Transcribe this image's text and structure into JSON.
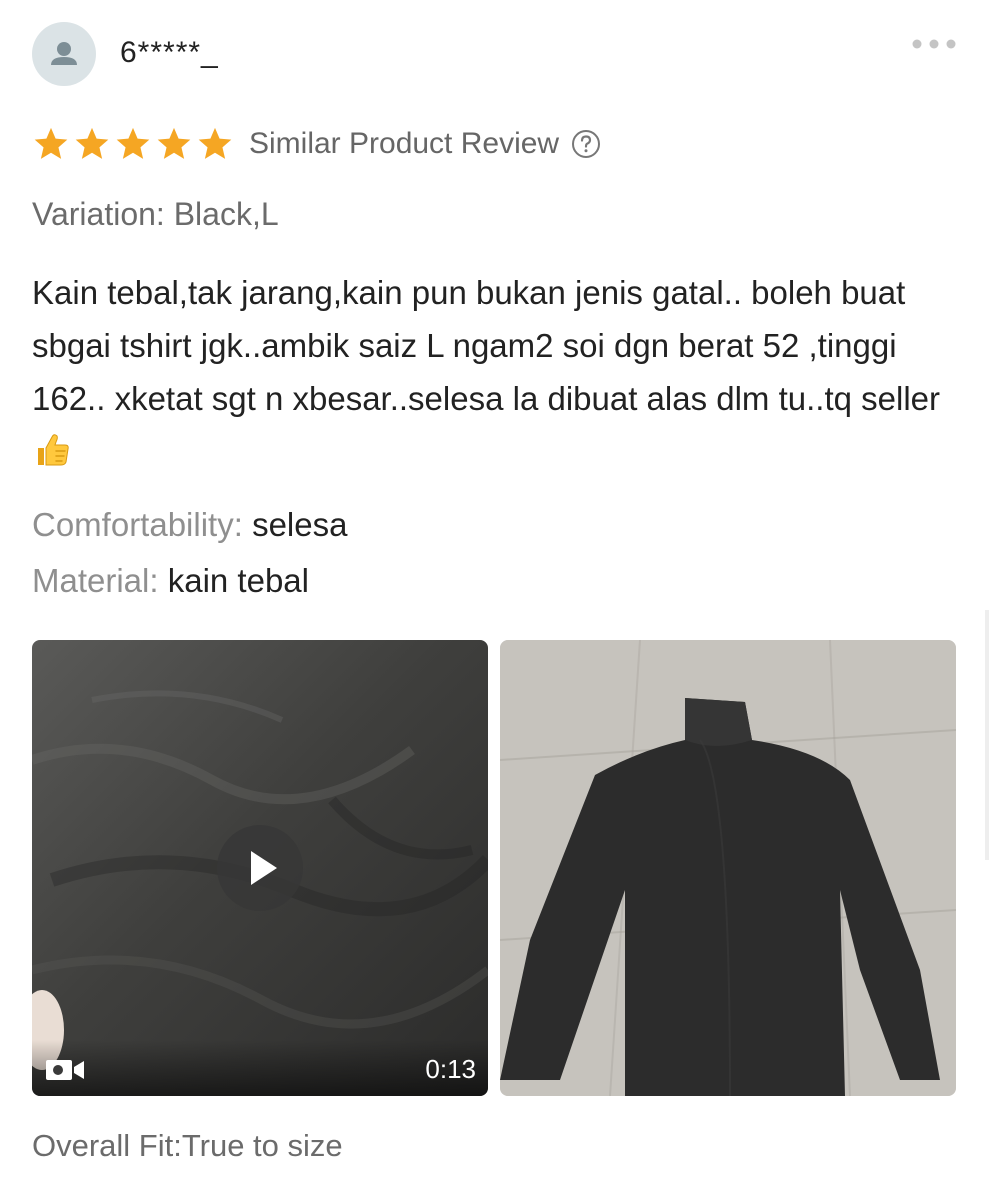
{
  "review": {
    "username": "6*****_",
    "rating": 5,
    "rating_max": 5,
    "similar_label": "Similar Product Review",
    "variation": "Variation: Black,L",
    "text": "Kain tebal,tak jarang,kain pun bukan jenis gatal.. boleh buat sbgai tshirt jgk..ambik saiz L ngam2 soi dgn berat 52 ,tinggi 162.. xketat sgt n xbesar..selesa la dibuat alas dlm tu..tq seller",
    "attributes": [
      {
        "label": "Comfortability:",
        "value": "selesa"
      },
      {
        "label": "Material:",
        "value": "kain tebal"
      }
    ],
    "media": {
      "video_duration": "0:13"
    },
    "overall_fit": "Overall Fit:True to size"
  },
  "icons": {
    "avatar": "user-avatar-icon",
    "more": "more-dots-icon",
    "star": "star-icon",
    "help": "question-circle-icon",
    "emoji": "thumbs-up-emoji",
    "play": "play-icon",
    "camera": "video-camera-icon"
  },
  "colors": {
    "star": "#f5a623",
    "secondary_text": "#6b6b6b",
    "primary_text": "#222222",
    "avatar_bg": "#dbe3e6"
  }
}
